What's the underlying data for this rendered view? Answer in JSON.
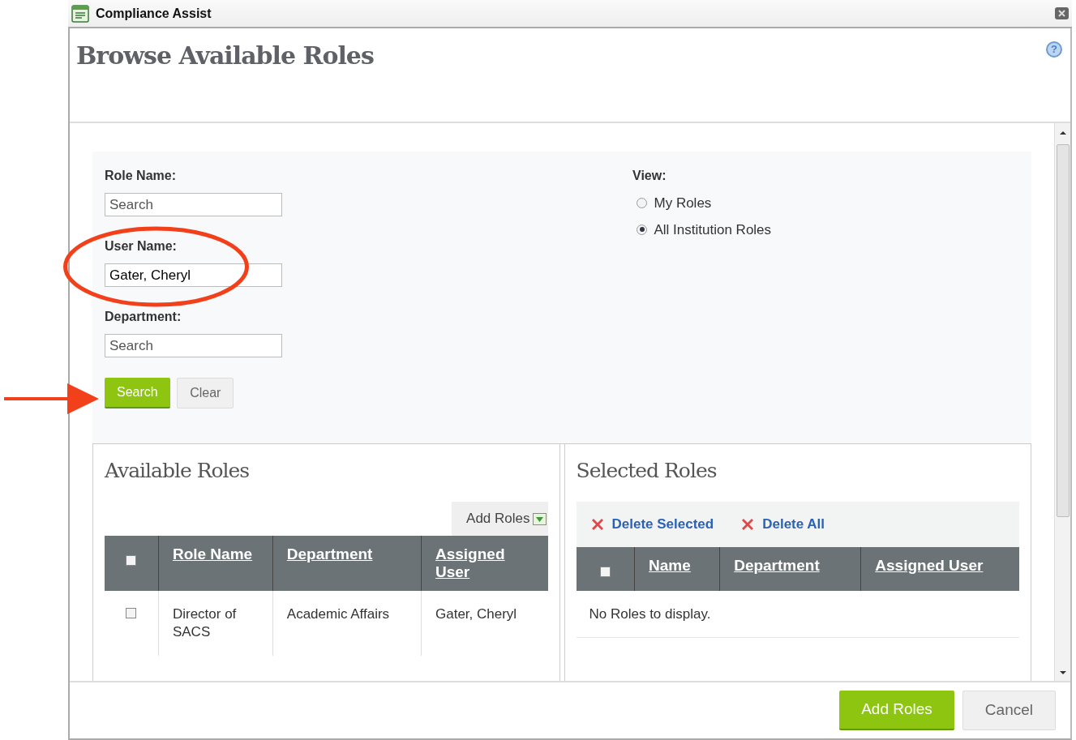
{
  "window": {
    "title": "Compliance Assist"
  },
  "help_icon": "?",
  "page_title": "Browse Available Roles",
  "filters": [
    {
      "label": "Role Name:",
      "placeholder": "Search"
    },
    {
      "label": "User Name:",
      "value": "Gater, Cheryl"
    },
    {
      "label": "Department:",
      "placeholder": "Search"
    }
  ],
  "view": {
    "label": "View:",
    "options": [
      {
        "label": "My Roles",
        "selected": false
      },
      {
        "label": "All Institution Roles",
        "selected": true
      }
    ]
  },
  "search_buttons": [
    {
      "label": "Search",
      "kind": "primary"
    },
    {
      "label": "Clear",
      "kind": "secondary"
    }
  ],
  "available_roles": {
    "title": "Available Roles",
    "add_roles": "Add Roles",
    "header_checked": false,
    "columns": [
      "Role Name",
      "Department",
      "Assigned User"
    ],
    "rows": [
      {
        "checked": false,
        "cells": [
          "Director of SACS",
          "Academic Affairs",
          "Gater, Cheryl"
        ]
      }
    ]
  },
  "selected_roles": {
    "title": "Selected Roles",
    "actions": [
      "Delete Selected",
      "Delete All"
    ],
    "header_checked": false,
    "columns": [
      "Name",
      "Department",
      "Assigned User"
    ],
    "empty_message": "No Roles to display."
  },
  "footer_buttons": [
    {
      "label": "Add Roles",
      "kind": "primary"
    },
    {
      "label": "Cancel",
      "kind": "secondary"
    }
  ]
}
